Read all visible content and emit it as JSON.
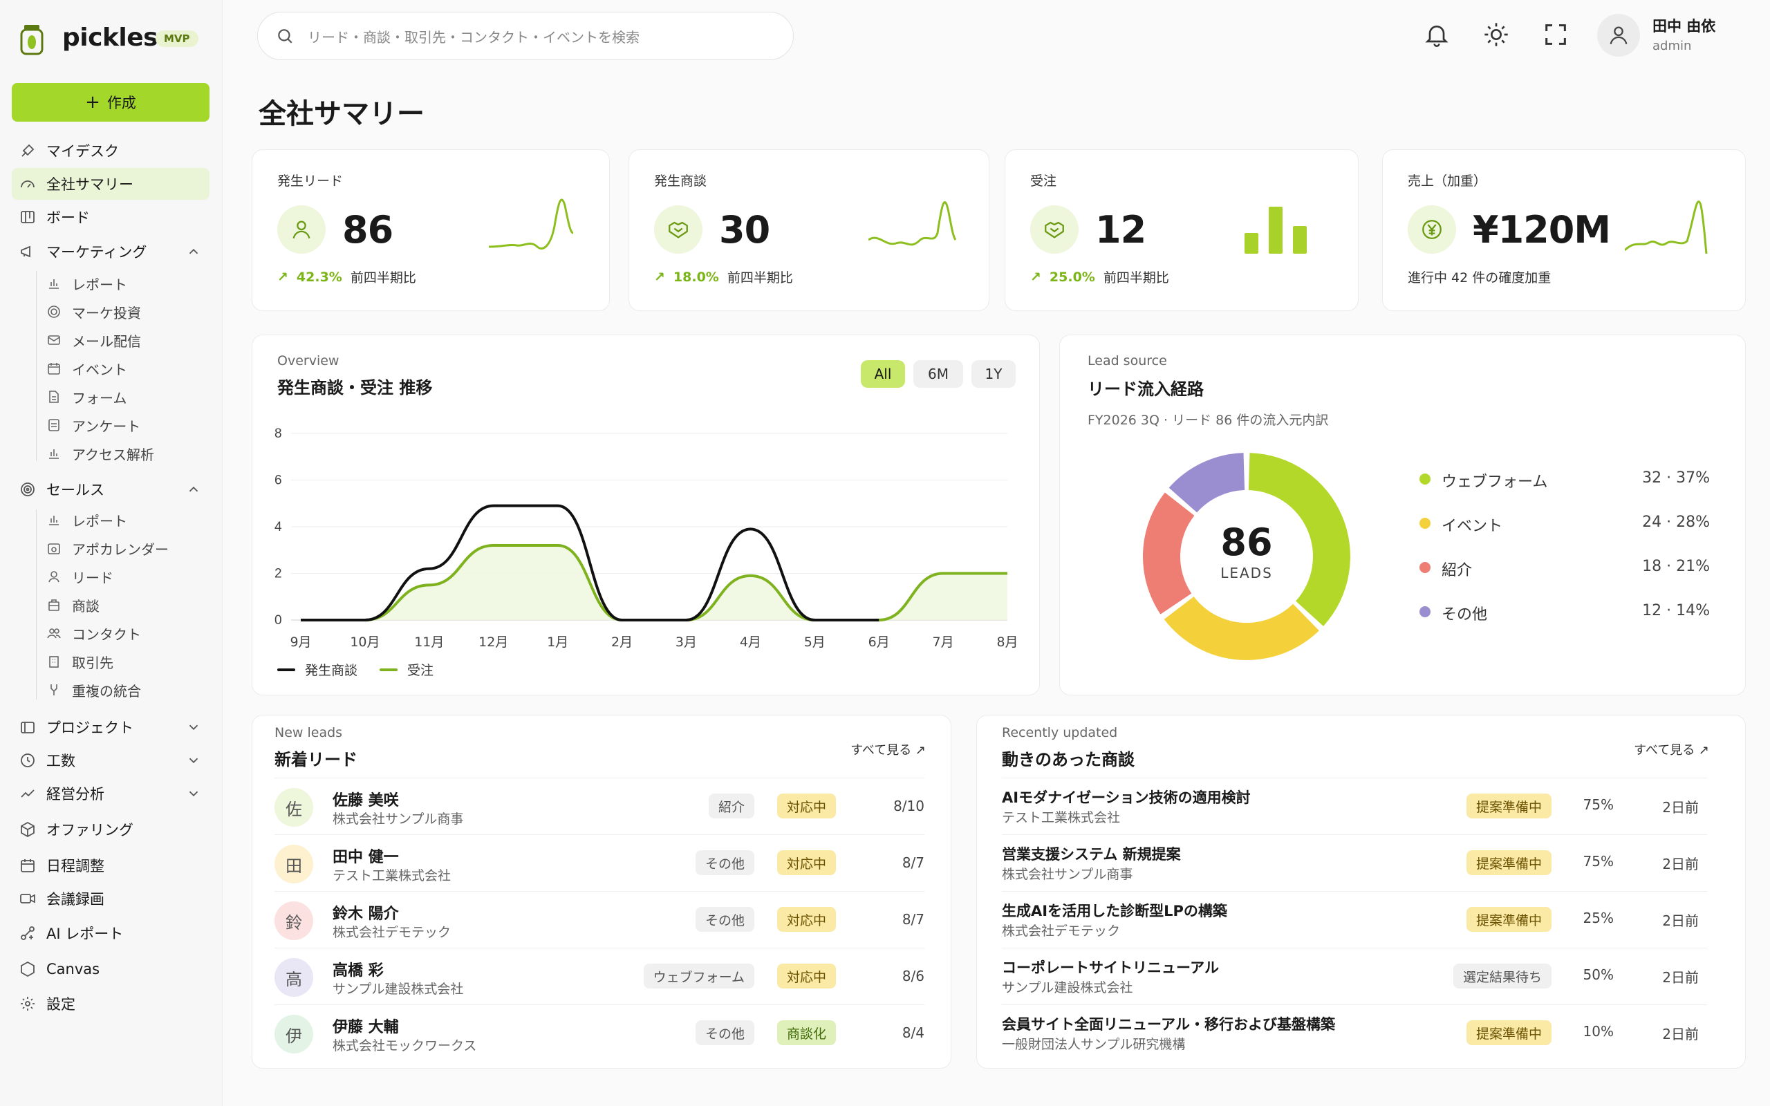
{
  "app": {
    "name": "pickles",
    "badge": "MVP"
  },
  "sidebar": {
    "create_label": "作成",
    "items": [
      {
        "label": "マイデスク",
        "icon": "desk-icon"
      },
      {
        "label": "全社サマリー",
        "icon": "gauge-icon",
        "active": true
      },
      {
        "label": "ボード",
        "icon": "board-icon"
      },
      {
        "label": "マーケティング",
        "icon": "megaphone-icon",
        "expanded": true
      },
      {
        "label": "セールス",
        "icon": "target-icon",
        "expanded": true
      },
      {
        "label": "プロジェクト",
        "icon": "folder-icon"
      },
      {
        "label": "工数",
        "icon": "clock-icon"
      },
      {
        "label": "経営分析",
        "icon": "trend-icon"
      },
      {
        "label": "オファリング",
        "icon": "cube-icon"
      },
      {
        "label": "日程調整",
        "icon": "calendar-icon"
      },
      {
        "label": "会議録画",
        "icon": "video-icon"
      },
      {
        "label": "AI レポート",
        "icon": "ai-icon"
      },
      {
        "label": "Canvas",
        "icon": "canvas-icon"
      },
      {
        "label": "設定",
        "icon": "gear-icon"
      }
    ],
    "marketing_sub": [
      "レポート",
      "マーケ投資",
      "メール配信",
      "イベント",
      "フォーム",
      "アンケート",
      "アクセス解析"
    ],
    "sales_sub": [
      "レポート",
      "アポカレンダー",
      "リード",
      "商談",
      "コンタクト",
      "取引先",
      "重複の統合"
    ]
  },
  "search": {
    "placeholder": "リード・商談・取引先・コンタクト・イベントを検索"
  },
  "user": {
    "name": "田中 由依",
    "role": "admin"
  },
  "page_title": "全社サマリー",
  "kpis": [
    {
      "label": "発生リード",
      "value": "86",
      "delta": "42.3%",
      "delta_note": "前四半期比",
      "icon": "person-icon"
    },
    {
      "label": "発生商談",
      "value": "30",
      "delta": "18.0%",
      "delta_note": "前四半期比",
      "icon": "handshake-icon"
    },
    {
      "label": "受注",
      "value": "12",
      "delta": "25.0%",
      "delta_note": "前四半期比",
      "icon": "handshake-icon"
    },
    {
      "label": "売上（加重）",
      "value": "¥120M",
      "note": "進行中 42 件の確度加重",
      "icon": "yen-icon"
    }
  ],
  "overview": {
    "sub": "Overview",
    "title": "発生商談・受注 推移",
    "ranges": [
      "All",
      "6M",
      "1Y"
    ],
    "selected_range": "All"
  },
  "chart_data": [
    {
      "type": "line",
      "title": "発生商談・受注 推移",
      "categories": [
        "9月",
        "10月",
        "11月",
        "12月",
        "1月",
        "2月",
        "3月",
        "4月",
        "5月",
        "6月",
        "7月",
        "8月"
      ],
      "ylim": [
        0,
        8
      ],
      "yticks": [
        0,
        2,
        4,
        6,
        8
      ],
      "grid": true,
      "legend": "bottom-left",
      "series": [
        {
          "name": "発生商談",
          "color": "#111111",
          "values": [
            0,
            0,
            2.2,
            4.9,
            4.9,
            0,
            0,
            3.9,
            0,
            0,
            null,
            null
          ]
        },
        {
          "name": "受注",
          "color": "#7fb21f",
          "values": [
            0,
            0,
            1.5,
            3.2,
            3.2,
            0,
            0,
            1.9,
            0,
            0,
            2,
            2
          ]
        }
      ]
    },
    {
      "type": "pie",
      "title": "リード流入経路",
      "center_value": "86",
      "center_label": "LEADS",
      "series": [
        {
          "name": "ウェブフォーム",
          "value": 32,
          "display": "32 · 37%",
          "color": "#b4d82a"
        },
        {
          "name": "イベント",
          "value": 24,
          "display": "24 · 28%",
          "color": "#f4d13a"
        },
        {
          "name": "紹介",
          "value": 18,
          "display": "18 · 21%",
          "color": "#ee7d74"
        },
        {
          "name": "その他",
          "value": 12,
          "display": "12 · 14%",
          "color": "#9b8ed0"
        }
      ]
    }
  ],
  "lead_source": {
    "sub": "Lead source",
    "title": "リード流入経路",
    "note": "FY2026 3Q · リード 86 件の流入元内訳"
  },
  "new_leads": {
    "sub": "New leads",
    "title": "新着リード",
    "see_all": "すべて見る ↗",
    "rows": [
      {
        "initial": "佐",
        "name": "佐藤 美咲",
        "company": "株式会社サンプル商事",
        "source": "紹介",
        "status": "対応中",
        "status_kind": "yellow",
        "date": "8/10",
        "avatar_color": "#eef6dc"
      },
      {
        "initial": "田",
        "name": "田中 健一",
        "company": "テスト工業株式会社",
        "source": "その他",
        "status": "対応中",
        "status_kind": "yellow",
        "date": "8/7",
        "avatar_color": "#fdf1d0"
      },
      {
        "initial": "鈴",
        "name": "鈴木 陽介",
        "company": "株式会社デモテック",
        "source": "その他",
        "status": "対応中",
        "status_kind": "yellow",
        "date": "8/7",
        "avatar_color": "#fbe1df"
      },
      {
        "initial": "高",
        "name": "高橋 彩",
        "company": "サンプル建設株式会社",
        "source": "ウェブフォーム",
        "status": "対応中",
        "status_kind": "yellow",
        "date": "8/6",
        "avatar_color": "#e9e6f6"
      },
      {
        "initial": "伊",
        "name": "伊藤 大輔",
        "company": "株式会社モックワークス",
        "source": "その他",
        "status": "商談化",
        "status_kind": "green",
        "date": "8/4",
        "avatar_color": "#e3f4e6"
      }
    ]
  },
  "recent_deals": {
    "sub": "Recently updated",
    "title": "動きのあった商談",
    "see_all": "すべて見る ↗",
    "rows": [
      {
        "name": "AIモダナイゼーション技術の適用検討",
        "company": "テスト工業株式会社",
        "stage": "提案準備中",
        "stage_kind": "yellow",
        "prob": "75%",
        "updated": "2日前"
      },
      {
        "name": "営業支援システム 新規提案",
        "company": "株式会社サンプル商事",
        "stage": "提案準備中",
        "stage_kind": "yellow",
        "prob": "75%",
        "updated": "2日前"
      },
      {
        "name": "生成AIを活用した診断型LPの構築",
        "company": "株式会社デモテック",
        "stage": "提案準備中",
        "stage_kind": "yellow",
        "prob": "25%",
        "updated": "2日前"
      },
      {
        "name": "コーポレートサイトリニューアル",
        "company": "サンプル建設株式会社",
        "stage": "選定結果待ち",
        "stage_kind": "gray",
        "prob": "50%",
        "updated": "2日前"
      },
      {
        "name": "会員サイト全面リニューアル・移行および基盤構築",
        "company": "一般財団法人サンプル研究機構",
        "stage": "提案準備中",
        "stage_kind": "yellow",
        "prob": "10%",
        "updated": "2日前"
      }
    ]
  }
}
